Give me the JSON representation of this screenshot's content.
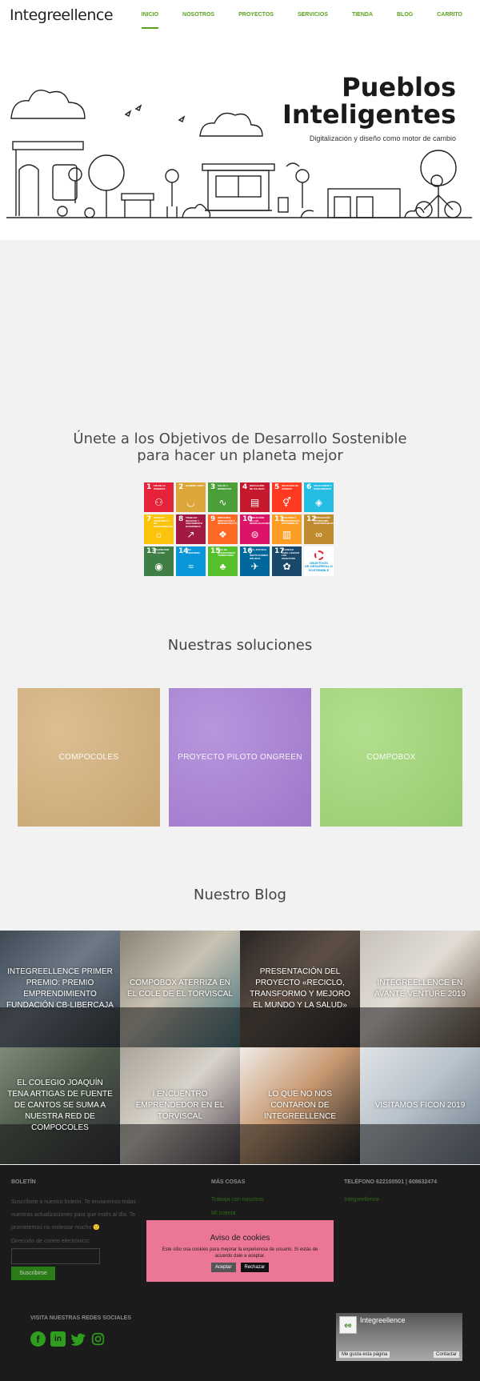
{
  "header": {
    "logo": "Integreellence",
    "nav": [
      "INICIO",
      "NOSOTROS",
      "PROYECTOS",
      "SERVICIOS",
      "TIENDA",
      "BLOG",
      "CARRITO"
    ]
  },
  "hero": {
    "title_line1": "Pueblos",
    "title_line2": "Inteligentes",
    "subtitle": "Digitalización y diseño como motor de cambio"
  },
  "ods": {
    "title_line1": "Únete a los Objetivos de Desarrollo Sostenible",
    "title_line2": "para hacer un planeta mejor",
    "tiles": [
      {
        "n": "1",
        "label": "FIN DE LA POBREZA",
        "color": "#e5243b",
        "icon": "people-icon"
      },
      {
        "n": "2",
        "label": "HAMBRE CERO",
        "color": "#dda63a",
        "icon": "bowl-icon"
      },
      {
        "n": "3",
        "label": "SALUD Y BIENESTAR",
        "color": "#4c9f38",
        "icon": "heartbeat-icon"
      },
      {
        "n": "4",
        "label": "EDUCACIÓN DE CALIDAD",
        "color": "#c5192d",
        "icon": "book-icon"
      },
      {
        "n": "5",
        "label": "IGUALDAD DE GÉNERO",
        "color": "#ff3a21",
        "icon": "gender-icon"
      },
      {
        "n": "6",
        "label": "AGUA LIMPIA Y SANEAMIENTO",
        "color": "#26bde2",
        "icon": "water-icon"
      },
      {
        "n": "7",
        "label": "ENERGÍA ASEQUIBLE Y NO CONTAMINANTE",
        "color": "#fcc30b",
        "icon": "sun-icon"
      },
      {
        "n": "8",
        "label": "TRABAJO DECENTE Y CRECIMIENTO ECONÓMICO",
        "color": "#a21942",
        "icon": "growth-icon"
      },
      {
        "n": "9",
        "label": "INDUSTRIA, INNOVACIÓN E INFRAESTRUCTURA",
        "color": "#fd6925",
        "icon": "cubes-icon"
      },
      {
        "n": "10",
        "label": "REDUCCIÓN DE LAS DESIGUALDADES",
        "color": "#dd1367",
        "icon": "equal-icon"
      },
      {
        "n": "11",
        "label": "CIUDADES Y COMUNIDADES SOSTENIBLES",
        "color": "#fd9d24",
        "icon": "city-icon"
      },
      {
        "n": "12",
        "label": "PRODUCCIÓN Y CONSUMO RESPONSABLES",
        "color": "#bf8b2e",
        "icon": "infinity-icon"
      },
      {
        "n": "13",
        "label": "ACCIÓN POR EL CLIMA",
        "color": "#3f7e44",
        "icon": "eye-icon"
      },
      {
        "n": "14",
        "label": "VIDA SUBMARINA",
        "color": "#0a97d9",
        "icon": "fish-icon"
      },
      {
        "n": "15",
        "label": "VIDA DE ECOSISTEMAS TERRESTRES",
        "color": "#56c02b",
        "icon": "tree-icon"
      },
      {
        "n": "16",
        "label": "PAZ, JUSTICIA E INSTITUCIONES SÓLIDAS",
        "color": "#00689d",
        "icon": "dove-icon"
      },
      {
        "n": "17",
        "label": "ALIANZAS PARA LOGRAR LOS OBJETIVOS",
        "color": "#19486a",
        "icon": "flower-icon"
      }
    ],
    "logo_text_line1": "OBJETIVOS",
    "logo_text_line2": "DE DESARROLLO",
    "logo_text_line3": "SOSTENIBLE"
  },
  "solutions": {
    "title": "Nuestras soluciones",
    "cards": [
      {
        "label": "COMPOCOLES",
        "color": "#d4b07a"
      },
      {
        "label": "PROYECTO PILOTO ONGREEN",
        "color": "#a87fd6"
      },
      {
        "label": "COMPOBOX",
        "color": "#a1d876"
      }
    ]
  },
  "blog": {
    "title": "Nuestro Blog",
    "posts": [
      {
        "title": "INTEGREELLENCE PRIMER PREMIO: PREMIO EMPRENDIMIENTO FUNDACIÓN CB-LIBERCAJA"
      },
      {
        "title": "COMPOBOX ATERRIZA EN EL COLE DE EL TORVISCAL"
      },
      {
        "title": "PRESENTACIÓN DEL PROYECTO «RECICLO, TRANSFORMO Y MEJORO EL MUNDO Y LA SALUD»"
      },
      {
        "title": "INTEGREELLENCE EN AVANTE VENTURE 2019"
      },
      {
        "title": "EL COLEGIO JOAQUÍN TENA ARTIGAS DE FUENTE DE CANTOS SE SUMA A NUESTRA RED DE COMPOCOLES"
      },
      {
        "title": "I ENCUENTRO EMPRENDEDOR EN EL TORVISCAL"
      },
      {
        "title": "LO QUE NO NOS CONTARON DE INTEGREELLENCE"
      },
      {
        "title": "VISITAMOS FICON 2019"
      }
    ]
  },
  "footer": {
    "newsletter_heading": "BOLETÍN",
    "newsletter_text": "Suscríbete a nuestro boletín. Te enviaremos todas nuestras actualizaciones para que estés al día. Te prometemos no molestar mucho 🙂",
    "email_label": "Dirección de correo electrónico:",
    "subscribe": "Suscribirse",
    "more_heading": "MÁS COSAS",
    "more_links": [
      "Trabaja con nosotros",
      "Mi cuenta"
    ],
    "phone_heading": "TELÉFONO 622100501 | 608632474",
    "phone_link": "Integreellence",
    "social_heading": "VISITA NUESTRAS REDES SOCIALES",
    "social_icons": [
      "facebook-icon",
      "linkedin-icon",
      "twitter-icon",
      "instagram-icon"
    ],
    "fb_name": "Integreellence",
    "fb_like": "Me gusta esta página",
    "fb_contact": "Contactar"
  },
  "cookie": {
    "title": "Aviso de cookies",
    "text": "Este sitio usa cookies para mejorar la experiencia de usuario. Si estás de acuerdo dale a aceptar.",
    "accept": "Aceptar",
    "reject": "Rechazar"
  }
}
